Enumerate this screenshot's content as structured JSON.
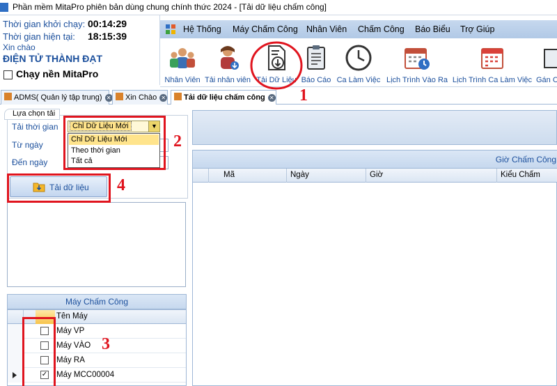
{
  "window": {
    "title": "Phần mềm MitaPro phiên bản dùng chung chính thức 2024 - [Tải dữ liệu chấm công]"
  },
  "info": {
    "start_label": "Thời gian khởi chạy:",
    "start_value": "00:14:29",
    "now_label": "Thời gian hiện tại:",
    "now_value": "18:15:39",
    "greeting": "Xin chào",
    "company": "ĐIỆN TỬ THÀNH ĐẠT",
    "background_run": "Chạy nền MitaPro"
  },
  "menu": {
    "items": [
      "Hệ Thống",
      "Máy Chấm Công",
      "Nhân Viên",
      "Chấm Công",
      "Báo Biểu",
      "Trợ Giúp"
    ]
  },
  "ribbon": {
    "buttons": [
      {
        "label": "Nhân Viên",
        "icon": "employees-icon"
      },
      {
        "label": "Tải nhân viên",
        "icon": "download-employee-icon"
      },
      {
        "label": "Tải Dữ Liệu",
        "icon": "download-data-icon"
      },
      {
        "label": "Báo Cáo",
        "icon": "report-icon"
      },
      {
        "label": "Ca Làm Việc",
        "icon": "clock-icon"
      },
      {
        "label": "Lịch Trình Vào Ra",
        "icon": "schedule-icon"
      },
      {
        "label": "Lịch Trình Ca Làm Việc",
        "icon": "calendar-icon"
      },
      {
        "label": "Gán C",
        "icon": "assign-icon"
      }
    ]
  },
  "tabs": [
    {
      "label": "ADMS( Quản lý tập trung)"
    },
    {
      "label": "Xin Chào"
    },
    {
      "label": "Tải dữ liệu chấm công"
    }
  ],
  "form": {
    "group_title": "Lựa chọn tải",
    "load_time_label": "Tải thời gian",
    "from_label": "Từ ngày",
    "to_label": "Đến ngày",
    "selected_option": "Chỉ Dữ Liệu Mới",
    "options": [
      "Chỉ Dữ Liệu Mới",
      "Theo thời gian",
      "Tất cả"
    ],
    "fetch_button": "Tải dữ liệu"
  },
  "machines": {
    "header": "Máy Chấm Công",
    "col_name": "Tên Máy",
    "rows": [
      {
        "name": "Máy VP",
        "checked": false
      },
      {
        "name": "Máy VÀO",
        "checked": false
      },
      {
        "name": "Máy RA",
        "checked": false
      },
      {
        "name": "Máy MCC00004",
        "checked": true
      }
    ]
  },
  "attendance_grid": {
    "title": "Giờ Chấm Công",
    "columns": [
      "Mã",
      "Ngày",
      "Giờ",
      "Kiểu Chấm"
    ]
  },
  "annotations": [
    "1",
    "2",
    "3",
    "4"
  ],
  "colors": {
    "accent": "#1b4f9c",
    "annotation": "#e0141e",
    "ribbon": "#c6d8ee"
  }
}
